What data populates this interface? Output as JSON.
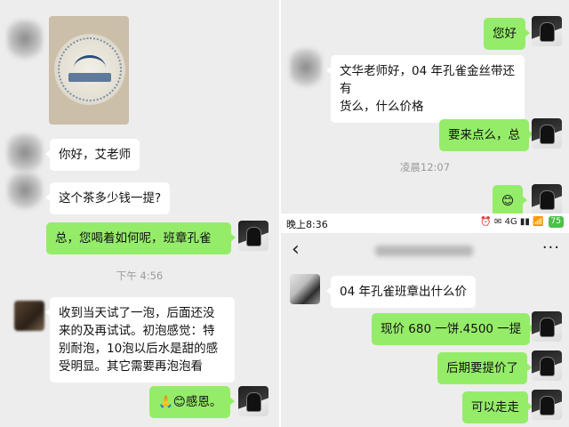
{
  "left_panel": {
    "messages": [
      {
        "text": "你好，艾老师"
      },
      {
        "text": "这个茶多少钱一提?"
      },
      {
        "text": "总，您喝着如何呢，班章孔雀"
      },
      {
        "text": "收到当天试了一泡，后面还没\n来的及再试试。初泡感觉：特\n别耐泡，10泡以后水是甜的感\n受明显。其它需要再泡泡看"
      },
      {
        "text": "🙏😊感恩。"
      }
    ],
    "timestamp": "下午 4:56"
  },
  "right_panel": {
    "top_messages": [
      {
        "text": "您好"
      },
      {
        "text": "文华老师好，04 年孔雀金丝带还有\n货么，什么价格"
      },
      {
        "text": "要来点么，总"
      },
      {
        "text": "😊"
      }
    ],
    "timestamp": "凌晨12:07",
    "status_bar": {
      "time": "晚上8:36",
      "icons": "⏰ ✉ 4G ▮▮ 📶",
      "battery": "75"
    },
    "nav": {
      "back_icon": "‹",
      "more_icon": "···"
    },
    "bottom_messages": [
      {
        "text": "04 年孔雀班章出什么价"
      },
      {
        "text": "现价 680 一饼.4500 一提"
      },
      {
        "text": "后期要提价了"
      },
      {
        "text": "可以走走"
      }
    ]
  }
}
